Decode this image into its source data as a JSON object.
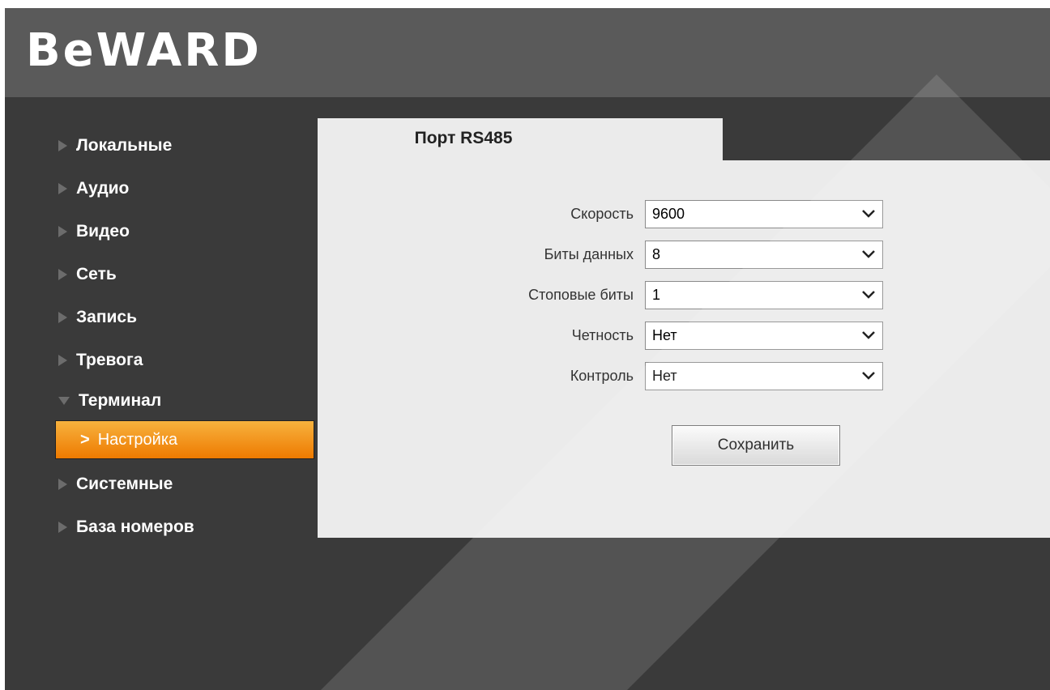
{
  "brand": {
    "logo_text": "BeWARD"
  },
  "sidebar": {
    "items": [
      {
        "label": "Локальные"
      },
      {
        "label": "Аудио"
      },
      {
        "label": "Видео"
      },
      {
        "label": "Сеть"
      },
      {
        "label": "Запись"
      },
      {
        "label": "Тревога"
      },
      {
        "label": "Терминал",
        "expanded": true
      },
      {
        "label": "Системные"
      },
      {
        "label": "База номеров"
      }
    ],
    "subitem": {
      "label": "Настройка",
      "chevron": ">",
      "active": true
    }
  },
  "tab": {
    "title": "Порт RS485"
  },
  "form": {
    "fields": [
      {
        "label": "Скорость",
        "value": "9600"
      },
      {
        "label": "Биты данных",
        "value": "8"
      },
      {
        "label": "Стоповые биты",
        "value": "1"
      },
      {
        "label": "Четность",
        "value": "Нет"
      },
      {
        "label": "Контроль",
        "value": "Нет"
      }
    ],
    "save_label": "Сохранить"
  },
  "colors": {
    "background": "#3a3a3a",
    "header": "#5a5a5a",
    "panel": "#ebebeb",
    "active_item_top": "#f7b23e",
    "active_item_bottom": "#ee7a00"
  },
  "icons": {
    "nav_collapsed": "triangle-right-icon",
    "nav_expanded": "triangle-down-icon",
    "select": "chevron-down-icon"
  }
}
